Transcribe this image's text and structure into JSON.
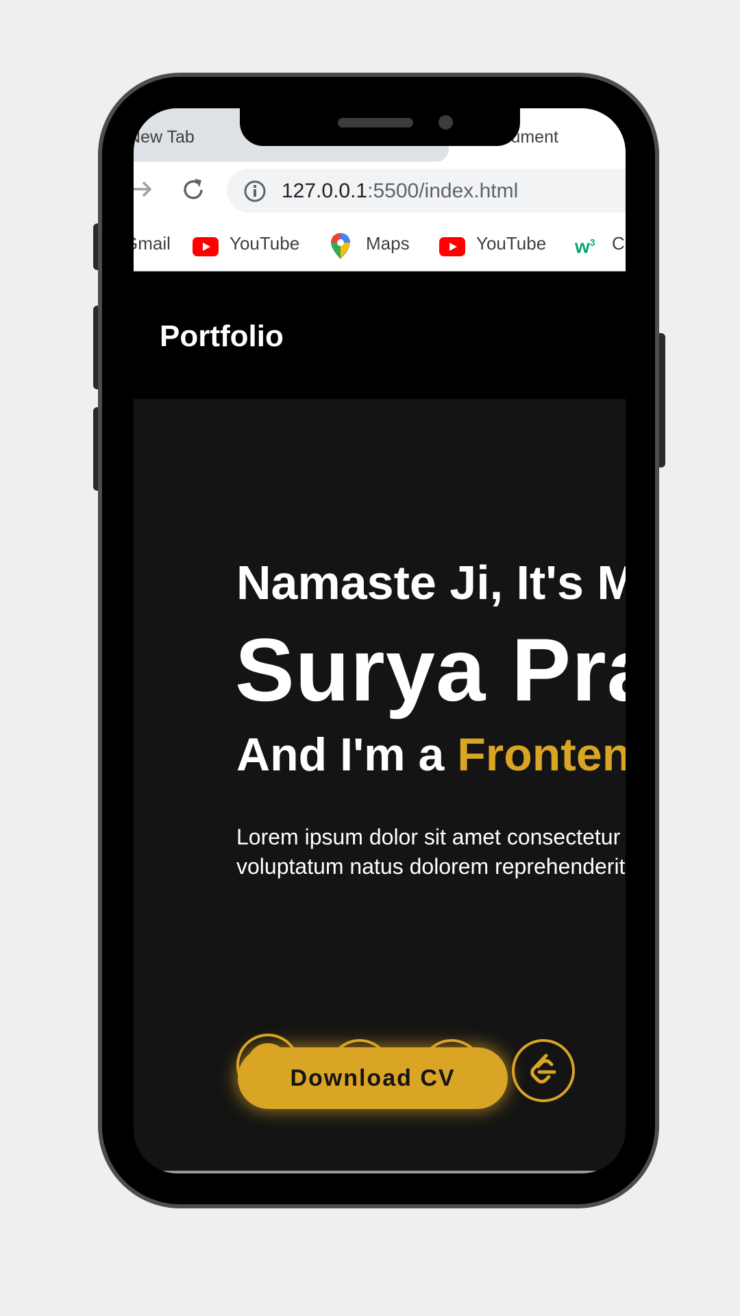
{
  "browser": {
    "tabs": [
      {
        "label": "New Tab",
        "active": false
      },
      {
        "label": "Document",
        "active": true
      }
    ],
    "url_host": "127.0.0.1",
    "url_path": ":5500/index.html",
    "bookmarks": [
      {
        "label": "Gmail",
        "icon": "gmail-icon"
      },
      {
        "label": "YouTube",
        "icon": "youtube-icon"
      },
      {
        "label": "Maps",
        "icon": "maps-icon"
      },
      {
        "label": "YouTube",
        "icon": "youtube-icon"
      },
      {
        "label": "C",
        "icon": "w3schools-icon"
      }
    ]
  },
  "page": {
    "logo": "Portfolio",
    "greeting": "Namaste Ji, It's Me",
    "name": "Surya Prakash",
    "role_prefix": "And I'm a ",
    "role": "Frontend Developer",
    "intro_line1": "Lorem ipsum dolor sit amet consectetur adipisicing elit.",
    "intro_line2": "voluptatum natus dolorem reprehenderit.",
    "socials": [
      "github-icon",
      "linkedin-icon",
      "instagram-icon",
      "leetcode-icon"
    ],
    "cta": "Download CV"
  },
  "colors": {
    "accent": "#daa425",
    "background": "#141414",
    "navbar": "#000000"
  }
}
